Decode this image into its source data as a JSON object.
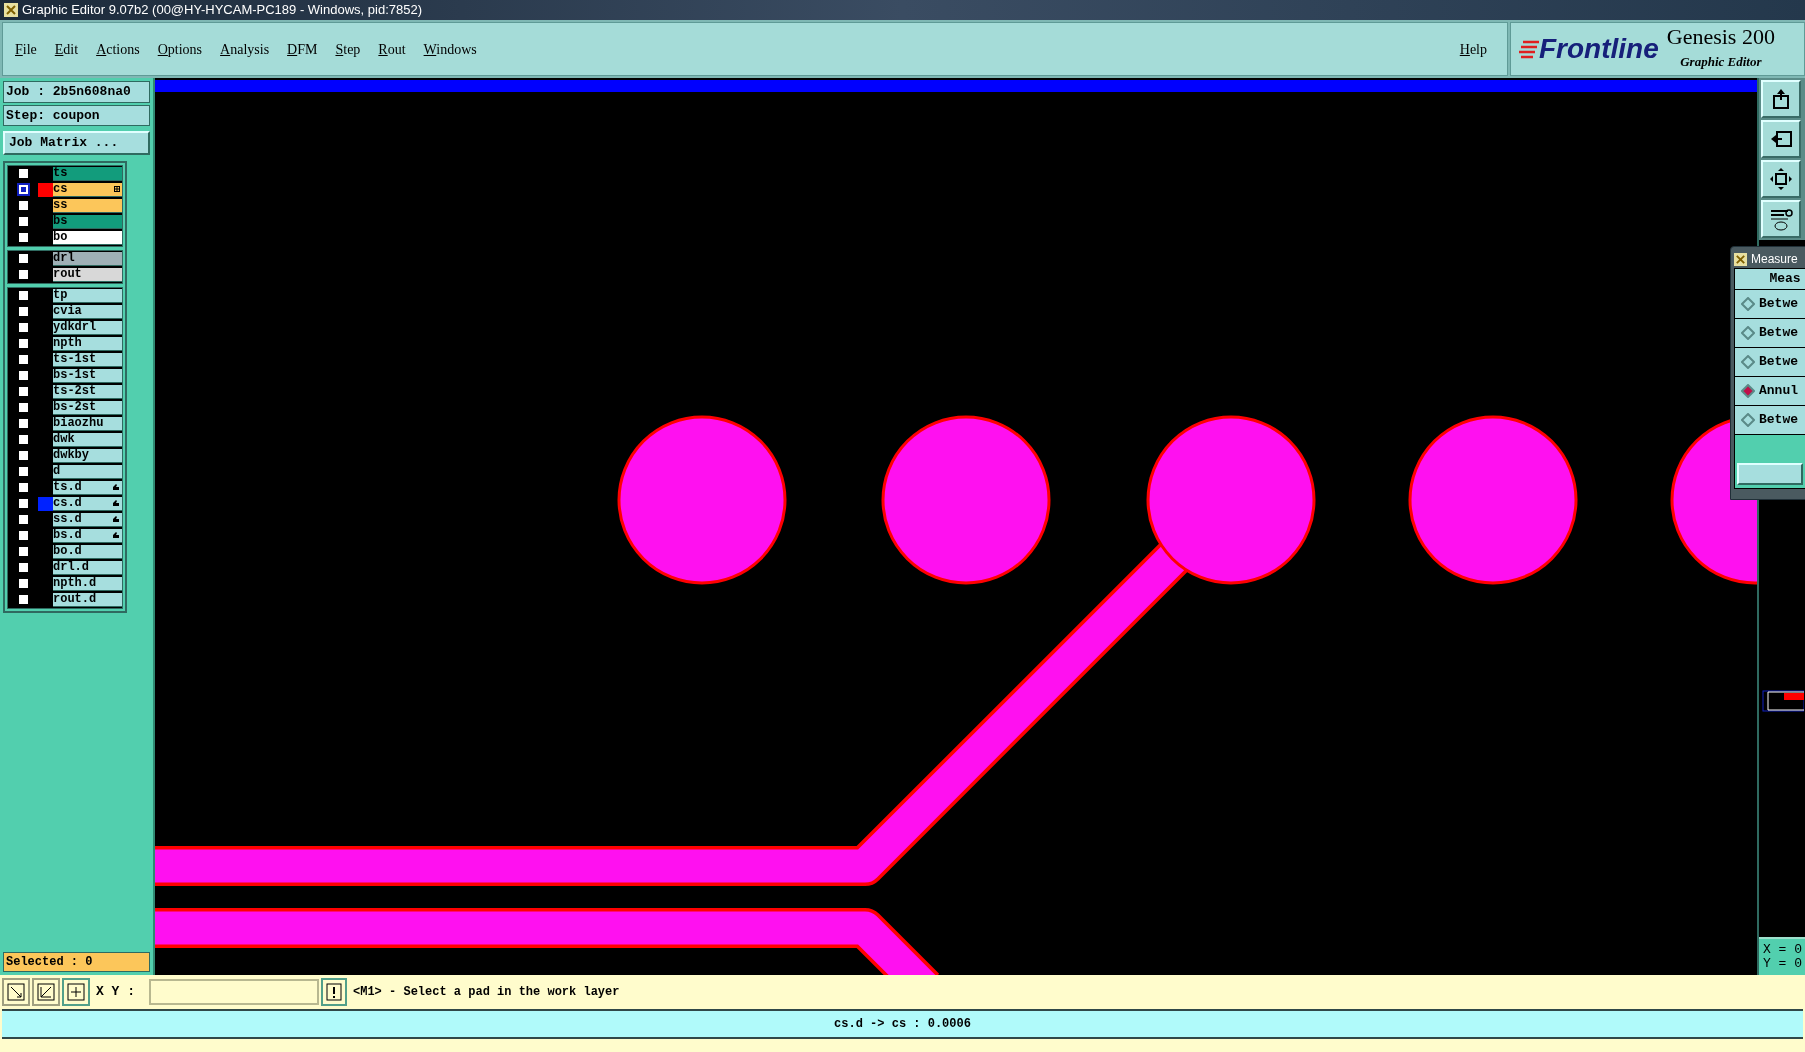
{
  "window": {
    "title": "Graphic Editor 9.07b2 (00@HY-HYCAM-PC189 - Windows, pid:7852)"
  },
  "menu": [
    "File",
    "Edit",
    "Actions",
    "Options",
    "Analysis",
    "DFM",
    "Step",
    "Rout",
    "Windows"
  ],
  "help": "Help",
  "logo": {
    "brand": "Frontline",
    "product": "Genesis 200",
    "subtitle": "Graphic Editor"
  },
  "job": "Job : 2b5n608na0",
  "step": "Step: coupon",
  "job_matrix": "Job Matrix ...",
  "layer_groups": [
    [
      {
        "name": "ts",
        "kind": "silk",
        "work": false,
        "linked": false
      },
      {
        "name": "cs",
        "kind": "signal",
        "work": true,
        "linked": false,
        "color": "#ff0000"
      },
      {
        "name": "ss",
        "kind": "signal",
        "work": false,
        "linked": false
      },
      {
        "name": "bs",
        "kind": "silk",
        "work": false,
        "linked": false
      },
      {
        "name": "bo",
        "kind": "board",
        "work": false,
        "linked": false
      }
    ],
    [
      {
        "name": "drl",
        "kind": "drill",
        "work": false,
        "linked": false
      },
      {
        "name": "rout",
        "kind": "rout",
        "work": false,
        "linked": false
      }
    ],
    [
      {
        "name": "tp",
        "kind": "misc",
        "work": false,
        "linked": false
      },
      {
        "name": "cvia",
        "kind": "misc",
        "work": false,
        "linked": false
      },
      {
        "name": "ydkdrl",
        "kind": "misc",
        "work": false,
        "linked": false
      },
      {
        "name": "npth",
        "kind": "misc",
        "work": false,
        "linked": false
      },
      {
        "name": "ts-1st",
        "kind": "misc",
        "work": false,
        "linked": false
      },
      {
        "name": "bs-1st",
        "kind": "misc",
        "work": false,
        "linked": false
      },
      {
        "name": "ts-2st",
        "kind": "misc",
        "work": false,
        "linked": false
      },
      {
        "name": "bs-2st",
        "kind": "misc",
        "work": false,
        "linked": false
      },
      {
        "name": "biaozhu",
        "kind": "misc",
        "work": false,
        "linked": false
      },
      {
        "name": "dwk",
        "kind": "misc",
        "work": false,
        "linked": false
      },
      {
        "name": "dwkby",
        "kind": "misc",
        "work": false,
        "linked": false
      },
      {
        "name": "d",
        "kind": "misc",
        "work": false,
        "linked": false
      },
      {
        "name": "ts.d",
        "kind": "misc",
        "work": false,
        "linked": true
      },
      {
        "name": "cs.d",
        "kind": "misc",
        "work": false,
        "linked": true,
        "color": "#0022ff"
      },
      {
        "name": "ss.d",
        "kind": "misc",
        "work": false,
        "linked": true
      },
      {
        "name": "bs.d",
        "kind": "misc",
        "work": false,
        "linked": true
      },
      {
        "name": "bo.d",
        "kind": "misc",
        "work": false,
        "linked": false
      },
      {
        "name": "drl.d",
        "kind": "misc",
        "work": false,
        "linked": false
      },
      {
        "name": "npth.d",
        "kind": "misc",
        "work": false,
        "linked": false
      },
      {
        "name": "rout.d",
        "kind": "misc",
        "work": false,
        "linked": false
      }
    ]
  ],
  "selected_count": "Selected : 0",
  "measure_dialog": {
    "title": "Measure",
    "header": "Meas",
    "options": [
      {
        "label": "Betwe",
        "selected": false
      },
      {
        "label": "Betwe",
        "selected": false
      },
      {
        "label": "Betwe",
        "selected": false
      },
      {
        "label": "Annul",
        "selected": true
      },
      {
        "label": "Betwe",
        "selected": false
      }
    ]
  },
  "coords": [
    "X = 0",
    "Y = 0"
  ],
  "prompt": {
    "label": "X Y :",
    "message": "<M1> - Select a pad in the work layer"
  },
  "status": "cs.d -> cs : 0.0006"
}
